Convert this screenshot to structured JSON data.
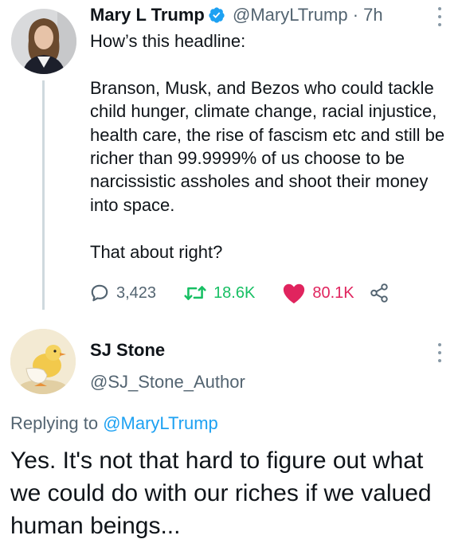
{
  "tweet": {
    "author_name": "Mary L Trump",
    "handle": "@MaryLTrump",
    "separator": "·",
    "time": "7h",
    "text": "How’s this headline:\n\nBranson, Musk, and Bezos who could tackle child hunger, climate change, racial injustice, health care, the rise of fascism etc and still be richer than 99.9999% of us choose to be narcissistic assholes and shoot their money into space.\n\nThat about right?",
    "reply_count": "3,423",
    "retweet_count": "18.6K",
    "like_count": "80.1K",
    "icons": {
      "reply": "reply-icon",
      "retweet": "retweet-icon",
      "like": "heart-icon",
      "share": "share-icon",
      "verified": "verified-badge-icon",
      "more": "more-icon"
    }
  },
  "reply": {
    "author_name": "SJ Stone",
    "handle": "@SJ_Stone_Author",
    "replying_prefix": "Replying to",
    "replying_to": "@MaryLTrump",
    "text": "Yes. It's not that hard to figure out what we could do with our riches if we valued human beings..."
  },
  "colors": {
    "text": "#0f1419",
    "muted": "#536471",
    "retweet": "#17bf63",
    "like": "#e0245e",
    "link": "#1da1f2",
    "verified": "#1da1f2"
  }
}
